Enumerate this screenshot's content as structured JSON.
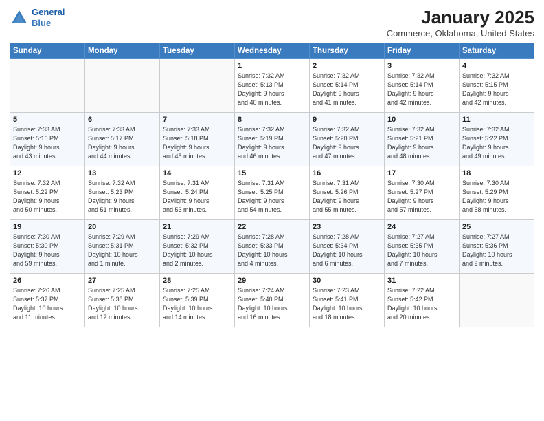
{
  "header": {
    "logo_line1": "General",
    "logo_line2": "Blue",
    "month_year": "January 2025",
    "location": "Commerce, Oklahoma, United States"
  },
  "weekdays": [
    "Sunday",
    "Monday",
    "Tuesday",
    "Wednesday",
    "Thursday",
    "Friday",
    "Saturday"
  ],
  "weeks": [
    [
      {
        "day": "",
        "info": ""
      },
      {
        "day": "",
        "info": ""
      },
      {
        "day": "",
        "info": ""
      },
      {
        "day": "1",
        "info": "Sunrise: 7:32 AM\nSunset: 5:13 PM\nDaylight: 9 hours\nand 40 minutes."
      },
      {
        "day": "2",
        "info": "Sunrise: 7:32 AM\nSunset: 5:14 PM\nDaylight: 9 hours\nand 41 minutes."
      },
      {
        "day": "3",
        "info": "Sunrise: 7:32 AM\nSunset: 5:14 PM\nDaylight: 9 hours\nand 42 minutes."
      },
      {
        "day": "4",
        "info": "Sunrise: 7:32 AM\nSunset: 5:15 PM\nDaylight: 9 hours\nand 42 minutes."
      }
    ],
    [
      {
        "day": "5",
        "info": "Sunrise: 7:33 AM\nSunset: 5:16 PM\nDaylight: 9 hours\nand 43 minutes."
      },
      {
        "day": "6",
        "info": "Sunrise: 7:33 AM\nSunset: 5:17 PM\nDaylight: 9 hours\nand 44 minutes."
      },
      {
        "day": "7",
        "info": "Sunrise: 7:33 AM\nSunset: 5:18 PM\nDaylight: 9 hours\nand 45 minutes."
      },
      {
        "day": "8",
        "info": "Sunrise: 7:32 AM\nSunset: 5:19 PM\nDaylight: 9 hours\nand 46 minutes."
      },
      {
        "day": "9",
        "info": "Sunrise: 7:32 AM\nSunset: 5:20 PM\nDaylight: 9 hours\nand 47 minutes."
      },
      {
        "day": "10",
        "info": "Sunrise: 7:32 AM\nSunset: 5:21 PM\nDaylight: 9 hours\nand 48 minutes."
      },
      {
        "day": "11",
        "info": "Sunrise: 7:32 AM\nSunset: 5:22 PM\nDaylight: 9 hours\nand 49 minutes."
      }
    ],
    [
      {
        "day": "12",
        "info": "Sunrise: 7:32 AM\nSunset: 5:22 PM\nDaylight: 9 hours\nand 50 minutes."
      },
      {
        "day": "13",
        "info": "Sunrise: 7:32 AM\nSunset: 5:23 PM\nDaylight: 9 hours\nand 51 minutes."
      },
      {
        "day": "14",
        "info": "Sunrise: 7:31 AM\nSunset: 5:24 PM\nDaylight: 9 hours\nand 53 minutes."
      },
      {
        "day": "15",
        "info": "Sunrise: 7:31 AM\nSunset: 5:25 PM\nDaylight: 9 hours\nand 54 minutes."
      },
      {
        "day": "16",
        "info": "Sunrise: 7:31 AM\nSunset: 5:26 PM\nDaylight: 9 hours\nand 55 minutes."
      },
      {
        "day": "17",
        "info": "Sunrise: 7:30 AM\nSunset: 5:27 PM\nDaylight: 9 hours\nand 57 minutes."
      },
      {
        "day": "18",
        "info": "Sunrise: 7:30 AM\nSunset: 5:29 PM\nDaylight: 9 hours\nand 58 minutes."
      }
    ],
    [
      {
        "day": "19",
        "info": "Sunrise: 7:30 AM\nSunset: 5:30 PM\nDaylight: 9 hours\nand 59 minutes."
      },
      {
        "day": "20",
        "info": "Sunrise: 7:29 AM\nSunset: 5:31 PM\nDaylight: 10 hours\nand 1 minute."
      },
      {
        "day": "21",
        "info": "Sunrise: 7:29 AM\nSunset: 5:32 PM\nDaylight: 10 hours\nand 2 minutes."
      },
      {
        "day": "22",
        "info": "Sunrise: 7:28 AM\nSunset: 5:33 PM\nDaylight: 10 hours\nand 4 minutes."
      },
      {
        "day": "23",
        "info": "Sunrise: 7:28 AM\nSunset: 5:34 PM\nDaylight: 10 hours\nand 6 minutes."
      },
      {
        "day": "24",
        "info": "Sunrise: 7:27 AM\nSunset: 5:35 PM\nDaylight: 10 hours\nand 7 minutes."
      },
      {
        "day": "25",
        "info": "Sunrise: 7:27 AM\nSunset: 5:36 PM\nDaylight: 10 hours\nand 9 minutes."
      }
    ],
    [
      {
        "day": "26",
        "info": "Sunrise: 7:26 AM\nSunset: 5:37 PM\nDaylight: 10 hours\nand 11 minutes."
      },
      {
        "day": "27",
        "info": "Sunrise: 7:25 AM\nSunset: 5:38 PM\nDaylight: 10 hours\nand 12 minutes."
      },
      {
        "day": "28",
        "info": "Sunrise: 7:25 AM\nSunset: 5:39 PM\nDaylight: 10 hours\nand 14 minutes."
      },
      {
        "day": "29",
        "info": "Sunrise: 7:24 AM\nSunset: 5:40 PM\nDaylight: 10 hours\nand 16 minutes."
      },
      {
        "day": "30",
        "info": "Sunrise: 7:23 AM\nSunset: 5:41 PM\nDaylight: 10 hours\nand 18 minutes."
      },
      {
        "day": "31",
        "info": "Sunrise: 7:22 AM\nSunset: 5:42 PM\nDaylight: 10 hours\nand 20 minutes."
      },
      {
        "day": "",
        "info": ""
      }
    ]
  ]
}
